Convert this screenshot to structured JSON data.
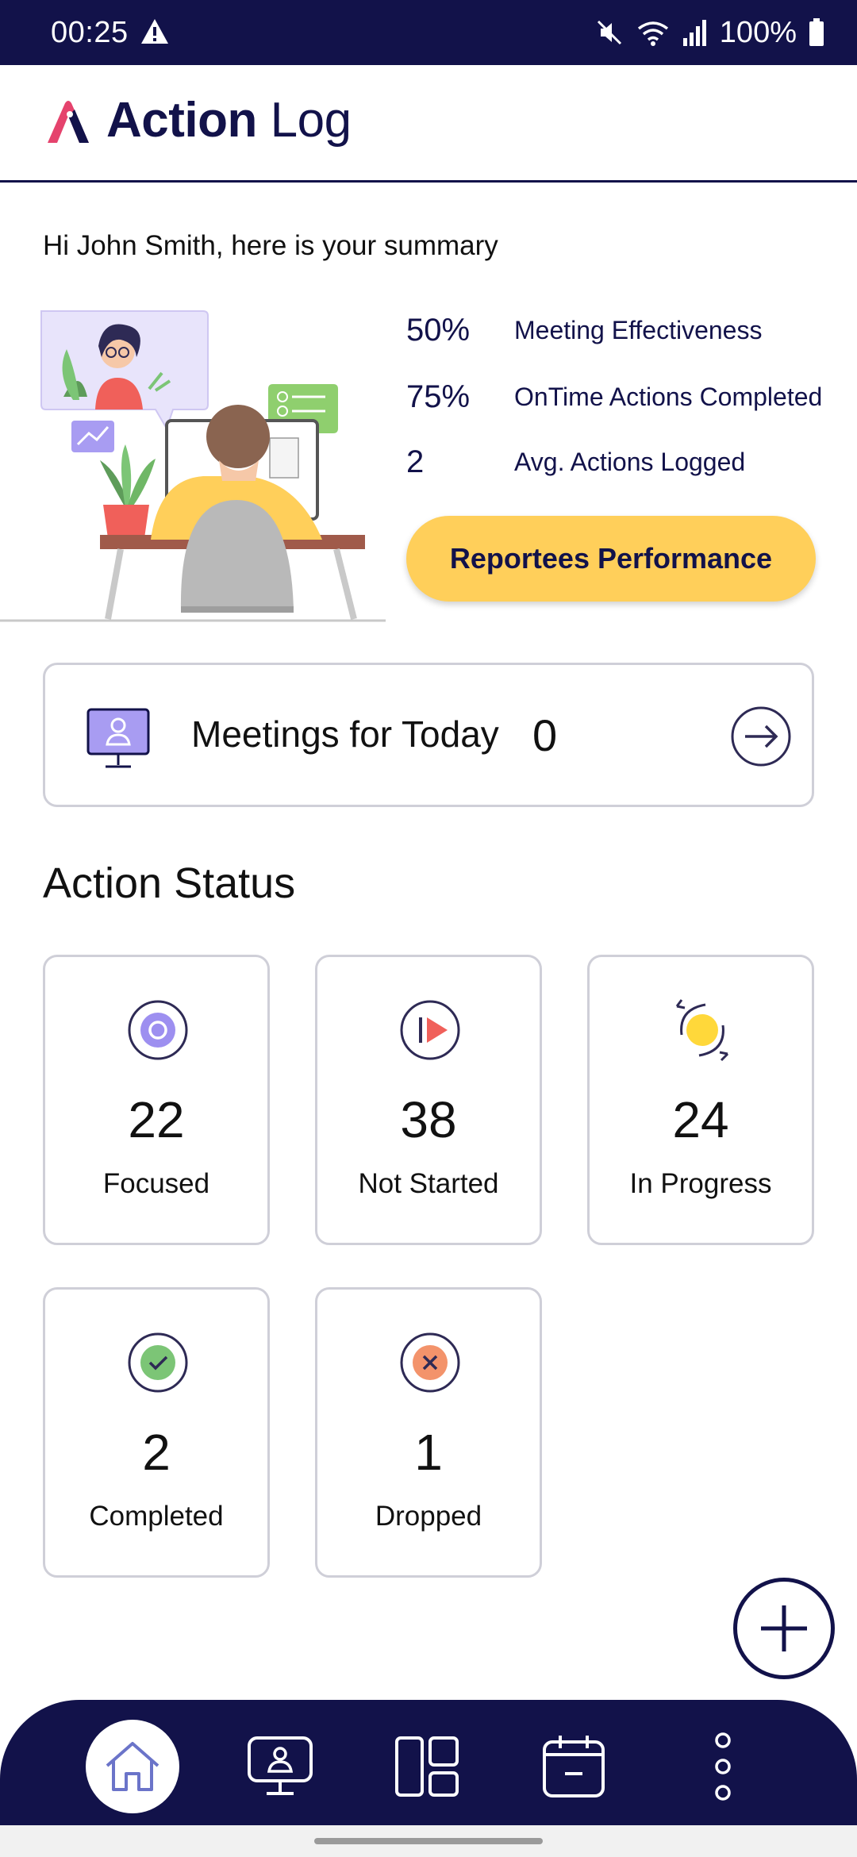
{
  "status_bar": {
    "time": "00:25",
    "battery_text": "100%",
    "icons": [
      "warning-icon",
      "mute-icon",
      "wifi-icon",
      "signal-icon",
      "battery-icon"
    ]
  },
  "header": {
    "title_bold": "Action",
    "title_light": "Log",
    "logo_colors": {
      "primary": "#e5436d",
      "secondary": "#12124a"
    }
  },
  "greeting": "Hi John Smith, here is your summary",
  "stats": [
    {
      "value": "50%",
      "label": "Meeting Effectiveness"
    },
    {
      "value": "75%",
      "label": "OnTime Actions Completed"
    },
    {
      "value": "2",
      "label": "Avg. Actions Logged"
    }
  ],
  "reportees_button": "Reportees Performance",
  "meetings": {
    "label": "Meetings for Today",
    "count": "0"
  },
  "action_status": {
    "title": "Action Status",
    "cards": [
      {
        "count": "22",
        "label": "Focused",
        "icon": "target-icon",
        "color": "#9d8ff0"
      },
      {
        "count": "38",
        "label": "Not Started",
        "icon": "play-icon",
        "color": "#f0605a"
      },
      {
        "count": "24",
        "label": "In Progress",
        "icon": "refresh-icon",
        "color": "#ffd83a"
      },
      {
        "count": "2",
        "label": "Completed",
        "icon": "check-icon",
        "color": "#7cc576"
      },
      {
        "count": "1",
        "label": "Dropped",
        "icon": "x-icon",
        "color": "#f3936b"
      }
    ]
  },
  "bottom_nav": {
    "items": [
      "home-icon",
      "meetings-icon",
      "dashboard-icon",
      "calendar-icon",
      "more-icon"
    ],
    "active": "home-icon"
  },
  "colors": {
    "navy": "#12124a",
    "accent_yellow": "#ffcf5a",
    "border": "#cfcfd8"
  }
}
